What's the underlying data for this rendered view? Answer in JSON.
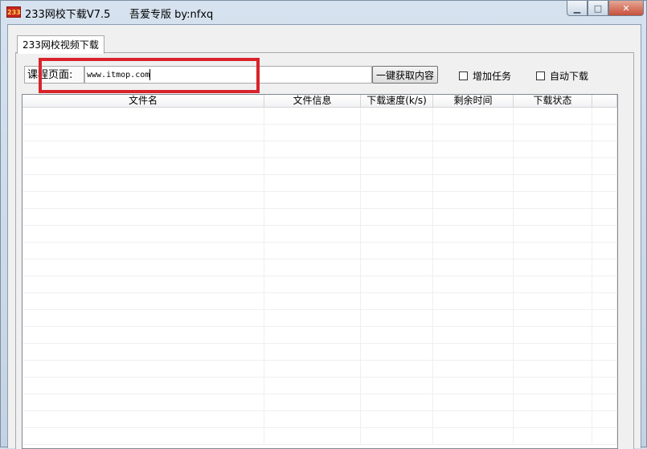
{
  "window": {
    "app_icon_text": "233",
    "title": "233网校下载V7.5",
    "subtitle": "吾爱专版  by:nfxq",
    "minimize_glyph": "▁",
    "maximize_glyph": "□",
    "close_glyph": "✕"
  },
  "tabs": [
    {
      "label": "233网校视频下载"
    }
  ],
  "form": {
    "url_label": "课程页面:",
    "url_value": "www.itmop.com",
    "fetch_button": "一键获取内容",
    "checkbox_add_task": "增加任务",
    "checkbox_auto_download": "自动下载"
  },
  "table": {
    "columns": [
      "文件名",
      "文件信息",
      "下载速度(k/s)",
      "剩余时间",
      "下载状态",
      ""
    ],
    "rows": []
  },
  "colors": {
    "highlight": "#d9232b",
    "titlebar": "#cfdcea"
  }
}
